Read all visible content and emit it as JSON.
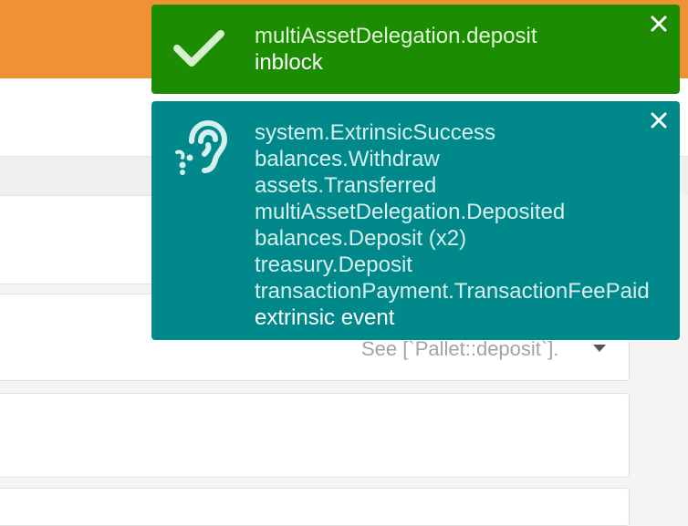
{
  "background": {
    "deposit_help_text": "See [`Pallet::deposit`].",
    "colors": {
      "topbar": "#f19135",
      "panel": "#ffffff",
      "page": "#f5f4f3"
    }
  },
  "notifications": [
    {
      "type": "success",
      "icon": "check-icon",
      "color": "#1c8c03",
      "lines": [
        "multiAssetDelegation.deposit"
      ],
      "status": "inblock"
    },
    {
      "type": "event",
      "icon": "hearing-ear-icon",
      "color": "#00888a",
      "lines": [
        "system.ExtrinsicSuccess",
        "balances.Withdraw",
        "assets.Transferred",
        "multiAssetDelegation.Deposited",
        "balances.Deposit (x2)",
        "treasury.Deposit",
        "transactionPayment.TransactionFeePaid"
      ],
      "status": "extrinsic event"
    }
  ]
}
